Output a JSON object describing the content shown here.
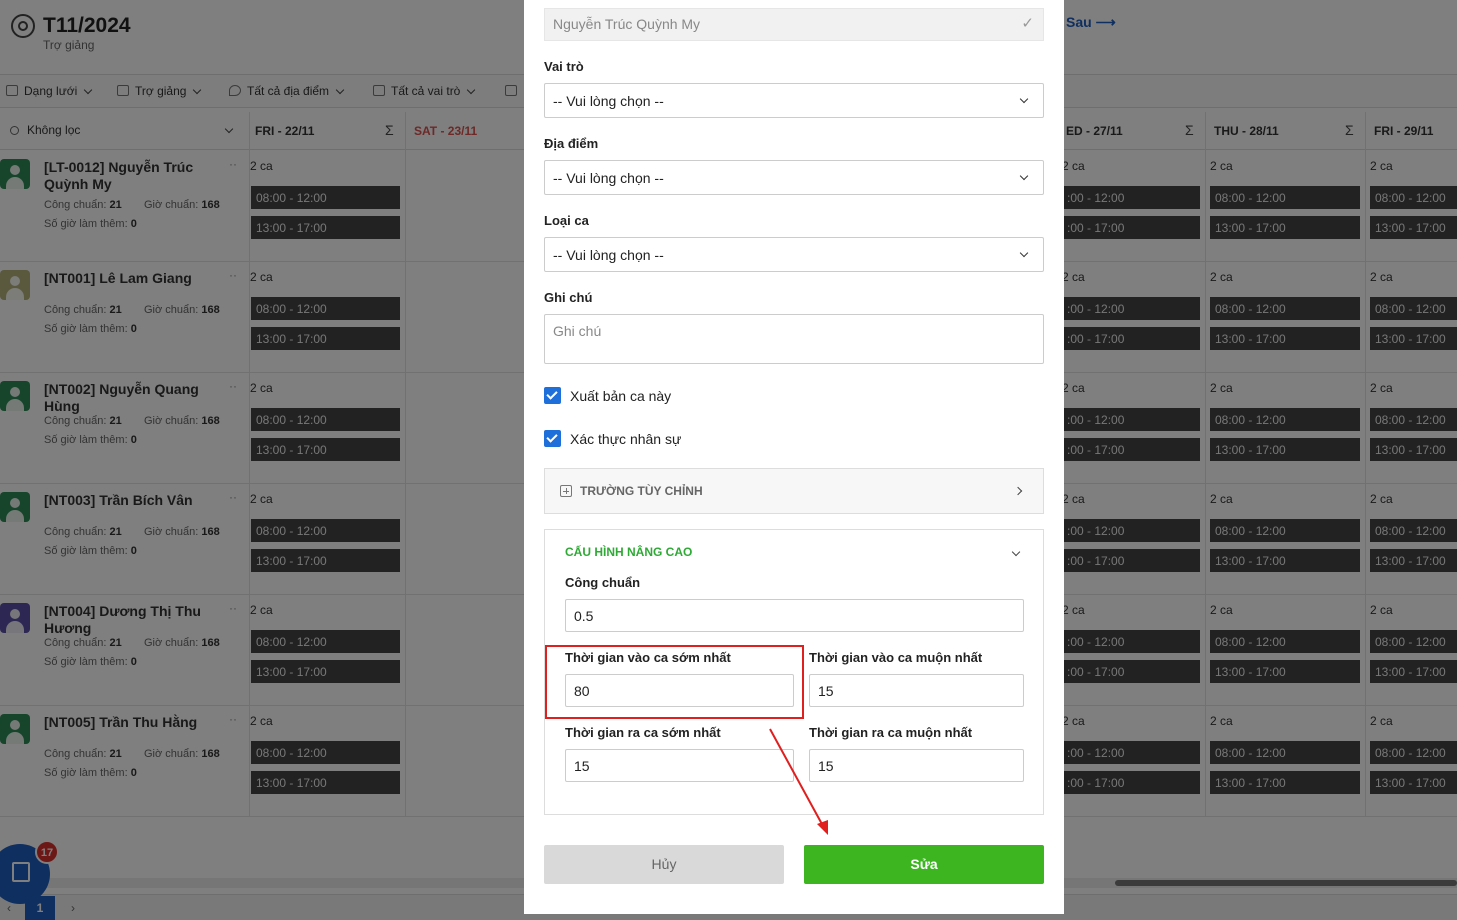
{
  "header": {
    "title": "T11/2024",
    "subtitle": "Trợ giảng",
    "next_label": "Sau ⟶"
  },
  "toolbar": {
    "items": [
      {
        "label": "Dạng lưới",
        "icon": "grid-icon"
      },
      {
        "label": "Trợ giảng",
        "icon": "calendar-icon"
      },
      {
        "label": "Tất cả địa điểm",
        "icon": "location-icon"
      },
      {
        "label": "Tất cả vai trò",
        "icon": "briefcase-icon"
      },
      {
        "label": "",
        "icon": "folder-icon"
      }
    ]
  },
  "grid": {
    "filter_label": "Không lọc",
    "sigma": "Σ",
    "columns": [
      {
        "label": "FRI - 22/11",
        "weekend": false
      },
      {
        "label": "SAT - 23/11",
        "weekend": true
      },
      {
        "label": "ED - 27/11",
        "weekend": false
      },
      {
        "label": "THU - 28/11",
        "weekend": false
      },
      {
        "label": "FRI - 29/11",
        "weekend": false
      }
    ],
    "cong_chuan_label": "Công chuẩn:",
    "gio_chuan_label": "Giờ chuẩn:",
    "ot_label": "Số giờ làm thêm:",
    "ca_count": "2 ca",
    "shifts": [
      "08:00 - 12:00",
      "13:00 - 17:00"
    ],
    "shifts_cut": [
      ":00 - 12:00",
      ":00 - 17:00"
    ],
    "employees": [
      {
        "name": "[LT-0012] Nguyễn Trúc Quỳnh My",
        "cong": "21",
        "gio": "168",
        "ot": "0",
        "avatar_color": "#2e8b57"
      },
      {
        "name": "[NT001] Lê Lam Giang",
        "cong": "21",
        "gio": "168",
        "ot": "0",
        "avatar_color": "#b5b27a"
      },
      {
        "name": "[NT002] Nguyễn Quang Hùng",
        "cong": "21",
        "gio": "168",
        "ot": "0",
        "avatar_color": "#2e8b57"
      },
      {
        "name": "[NT003] Trần Bích Vân",
        "cong": "21",
        "gio": "168",
        "ot": "0",
        "avatar_color": "#2e8b57"
      },
      {
        "name": "[NT004] Dương Thị Thu Hương",
        "cong": "21",
        "gio": "168",
        "ot": "0",
        "avatar_color": "#5b4ea8"
      },
      {
        "name": "[NT005] Trần Thu Hằng",
        "cong": "21",
        "gio": "168",
        "ot": "0",
        "avatar_color": "#2e8b57"
      }
    ],
    "more_icon": "··"
  },
  "pager": {
    "current": "1",
    "prev": "‹",
    "next": "›"
  },
  "fab": {
    "badge": "17",
    "icon": "clipboard-check-icon"
  },
  "modal": {
    "employee_value": "Nguyễn Trúc Quỳnh My",
    "role_label": "Vai trò",
    "role_value": "-- Vui lòng chọn --",
    "location_label": "Địa điểm",
    "location_value": "-- Vui lòng chọn --",
    "shift_type_label": "Loại ca",
    "shift_type_value": "-- Vui lòng chọn --",
    "note_label": "Ghi chú",
    "note_placeholder": "Ghi chú",
    "publish_label": "Xuất bản ca này",
    "publish_checked": true,
    "verify_label": "Xác thực nhân sự",
    "verify_checked": true,
    "custom_fields_title": "TRƯỜNG TÙY CHỈNH",
    "advanced_title": "CẤU HÌNH NÂNG CAO",
    "standard_work_label": "Công chuẩn",
    "standard_work_value": "0.5",
    "earliest_in_label": "Thời gian vào ca sớm nhất",
    "earliest_in_value": "80",
    "latest_in_label": "Thời gian vào ca muộn nhất",
    "latest_in_value": "15",
    "earliest_out_label": "Thời gian ra ca sớm nhất",
    "earliest_out_value": "15",
    "latest_out_label": "Thời gian ra ca muộn nhất",
    "latest_out_value": "15",
    "cancel_label": "Hủy",
    "save_label": "Sửa",
    "colors": {
      "primary": "#3cb521",
      "accent_title": "#2eaa35",
      "checkbox": "#1e6fd9",
      "annotation": "#e01f1f"
    }
  }
}
